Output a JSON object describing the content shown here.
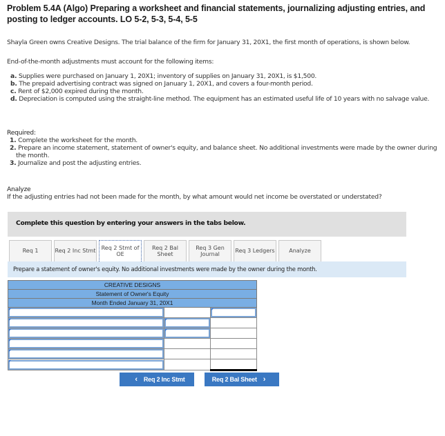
{
  "problem": {
    "title": "Problem 5.4A (Algo) Preparing a worksheet and financial statements, journalizing adjusting entries, and posting to ledger accounts. LO 5-2, 5-3, 5-4, 5-5",
    "intro": "Shayla Green owns Creative Designs. The trial balance of the firm for January 31, 20X1, the first month of operations, is shown below.",
    "adjustments_heading": "End-of-the-month adjustments must account for the following items:",
    "adjustments": [
      {
        "letter": "a.",
        "text": "Supplies were purchased on January 1, 20X1; inventory of supplies on January 31, 20X1, is $1,500."
      },
      {
        "letter": "b.",
        "text": "The prepaid advertising contract was signed on January 1, 20X1, and covers a four-month period."
      },
      {
        "letter": "c.",
        "text": "Rent of $2,000 expired during the month."
      },
      {
        "letter": "d.",
        "text": "Depreciation is computed using the straight-line method. The equipment has an estimated useful life of 10 years with no salvage value."
      }
    ],
    "required_heading": "Required:",
    "required": [
      {
        "num": "1.",
        "text": "Complete the worksheet for the month."
      },
      {
        "num": "2.",
        "text": "Prepare an income statement, statement of owner's equity, and balance sheet. No additional investments were made by the owner during the month."
      },
      {
        "num": "3.",
        "text": "Journalize and post the adjusting entries."
      }
    ],
    "analyze_heading": "Analyze",
    "analyze_text": "If the adjusting entries had not been made for the month, by what amount would net income be overstated or understated?"
  },
  "instructions": "Complete this question by entering your answers in the tabs below.",
  "tabs": [
    {
      "label": "Req 1",
      "active": false
    },
    {
      "label": "Req 2 Inc Stmt",
      "active": false
    },
    {
      "label": "Req 2 Stmt of OE",
      "active": true
    },
    {
      "label": "Req 2 Bal Sheet",
      "active": false
    },
    {
      "label": "Req 3 Gen Journal",
      "active": false
    },
    {
      "label": "Req 3 Ledgers",
      "active": false
    },
    {
      "label": "Analyze",
      "active": false
    }
  ],
  "tab_prompt": "Prepare a statement of owner's equity. No additional investments were made by the owner during the month.",
  "statement": {
    "company": "CREATIVE DESIGNS",
    "name": "Statement of Owner's Equity",
    "period": "Month Ended January 31, 20X1",
    "rows": [
      {
        "label": "",
        "mid": "",
        "right": ""
      },
      {
        "label": "",
        "mid": "",
        "right": ""
      },
      {
        "label": "",
        "mid": "",
        "right": ""
      },
      {
        "label": "",
        "mid": "",
        "right": ""
      },
      {
        "label": "",
        "mid": "",
        "right": ""
      },
      {
        "label": "",
        "mid": "",
        "right": ""
      }
    ]
  },
  "nav": {
    "prev_label": "Req 2 Inc Stmt",
    "next_label": "Req 2 Bal Sheet",
    "prev_icon": "chevron-left-icon",
    "next_icon": "chevron-right-icon"
  },
  "colors": {
    "header_blue": "#79aee4",
    "button_blue": "#3a78c2",
    "prompt_bg": "#dbe9f6",
    "instr_bg": "#e0e0e0"
  }
}
